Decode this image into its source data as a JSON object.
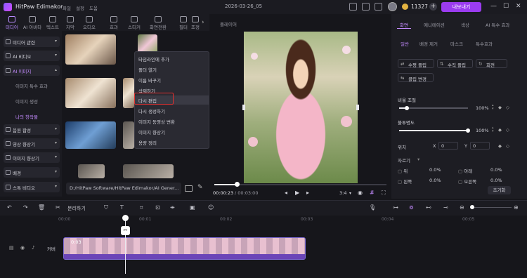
{
  "app": {
    "name": "HitPaw Edimakor",
    "menu": [
      "파일",
      "설정",
      "도움"
    ],
    "project": "2026-03-26_05",
    "credits": "11327",
    "export": "내보내기"
  },
  "toptabs": [
    {
      "label": "미디어",
      "icon": "media-icon",
      "active": true
    },
    {
      "label": "AI 아바타",
      "icon": "avatar-icon"
    },
    {
      "label": "텍스트",
      "icon": "text-icon"
    },
    {
      "label": "자막",
      "icon": "subtitle-icon"
    },
    {
      "label": "오디오",
      "icon": "audio-icon"
    },
    {
      "label": "효과",
      "icon": "effects-icon"
    },
    {
      "label": "스티커",
      "icon": "sticker-icon"
    },
    {
      "label": "화면전환",
      "icon": "transition-icon"
    },
    {
      "label": "필터",
      "icon": "filter-icon"
    },
    {
      "label": "조정",
      "icon": "adjust-icon"
    }
  ],
  "sidebar": {
    "items": [
      {
        "label": "미디어 관련"
      },
      {
        "label": "AI 비디오"
      },
      {
        "label": "AI 이미지",
        "active": true
      },
      {
        "label": "음원 합성"
      },
      {
        "label": "영상 향상기"
      },
      {
        "label": "이미지 향상기"
      },
      {
        "label": "배경"
      },
      {
        "label": "스톡 비디오"
      }
    ],
    "subitems": [
      {
        "label": "이미지 특수 효과"
      },
      {
        "label": "이미지 생성"
      },
      {
        "label": "나의 창작물",
        "active": true
      }
    ]
  },
  "context_menu": {
    "items": [
      "타임라인에 추가",
      "폴더 열기",
      "이름 바꾸기",
      "삭제하기",
      "다시 편집",
      "다시 생성하기",
      "이미지 동영상 변환",
      "이미지 향상기",
      "용량 정리"
    ],
    "highlighted_index": 4
  },
  "media": {
    "path": "D:/HitPaw Software/HitPaw Edimakor/AI Gener..."
  },
  "player": {
    "label": "플레이어",
    "current_time": "00:00:23",
    "total_time": "/ 00:03:00",
    "ratio": "3:4",
    "progress": 0.13
  },
  "right_panel": {
    "tabs": [
      "화면",
      "애니메이션",
      "색상",
      "AI 특수 효과"
    ],
    "subtabs": [
      "일반",
      "배경 제거",
      "마스크",
      "특수효과"
    ],
    "buttons": [
      "수평 플립",
      "수직 플립",
      "회전",
      "클립 변경"
    ],
    "scale": {
      "label": "비율 조절",
      "value": "100%",
      "fraction": 0.11
    },
    "opacity": {
      "label": "불투명도",
      "value": "100%",
      "fraction": 1.0
    },
    "position": {
      "label": "위치",
      "x_label": "X",
      "x_value": "0",
      "y_label": "Y",
      "y_value": "0"
    },
    "crop": {
      "label": "자르기",
      "fields": [
        {
          "label": "위",
          "value": "0.0%"
        },
        {
          "label": "아래",
          "value": "0.0%"
        },
        {
          "label": "왼쪽",
          "value": "0.0%"
        },
        {
          "label": "오른쪽",
          "value": "0.0%"
        }
      ]
    },
    "reset": "초기화"
  },
  "timeline": {
    "split_label": "분리하기",
    "ruler": [
      "00:00",
      "00:01",
      "00:02",
      "00:03",
      "00:04",
      "00:05"
    ],
    "clip_time": "0:03",
    "track_label": "커버"
  }
}
